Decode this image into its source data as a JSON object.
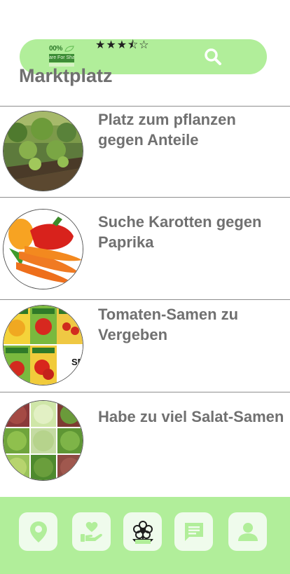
{
  "header": {
    "logo_text_top": "00%",
    "logo_text_band": "are For Share",
    "rating_stars": [
      "★",
      "★",
      "★",
      "⯪",
      "☆"
    ],
    "rating_value": 3.5,
    "rating_max": 5
  },
  "page": {
    "title": "Marktplatz"
  },
  "listings": [
    {
      "title": "Platz zum pflanzen gegen Anteile",
      "image": "garden-bed-photo"
    },
    {
      "title": "Suche Karotten gegen Paprika",
      "image": "carrots-peppers-photo"
    },
    {
      "title": "Tomaten-Samen zu Vergeben",
      "image": "tomato-seed-packets-photo",
      "image_text": "SE"
    },
    {
      "title": "Habe zu viel Salat-Samen",
      "image": "lettuce-varieties-photo"
    }
  ],
  "bottom_nav": {
    "items": [
      {
        "icon": "location-pin-icon"
      },
      {
        "icon": "heart-hand-icon"
      },
      {
        "icon": "flower-icon"
      },
      {
        "icon": "chat-icon"
      },
      {
        "icon": "profile-icon"
      }
    ]
  },
  "colors": {
    "accent_green": "#b1ee9a",
    "nav_button_bg": "#effbec",
    "text_gray": "#707070"
  }
}
